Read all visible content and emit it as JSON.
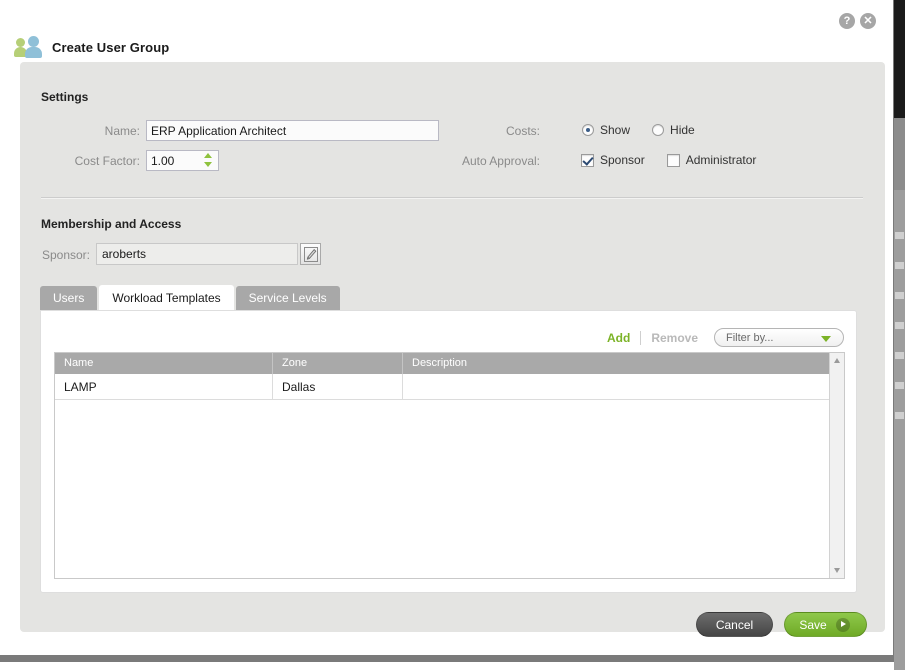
{
  "window": {
    "title": "Create User Group",
    "group_icon": "users-group-icon",
    "help_label": "?",
    "close_label": "✕"
  },
  "settings": {
    "heading": "Settings",
    "name_label": "Name:",
    "name_value": "ERP Application Architect",
    "name_placeholder": "",
    "cost_factor_label": "Cost Factor:",
    "cost_factor_value": "1.00",
    "costs_label": "Costs:",
    "costs_options": [
      {
        "label": "Show",
        "selected": true
      },
      {
        "label": "Hide",
        "selected": false
      }
    ],
    "auto_approval_label": "Auto Approval:",
    "auto_approval_options": [
      {
        "label": "Sponsor",
        "checked": true
      },
      {
        "label": "Administrator",
        "checked": false
      }
    ]
  },
  "membership": {
    "heading": "Membership and Access",
    "sponsor_label": "Sponsor:",
    "sponsor_value": "aroberts",
    "sponsor_placeholder": "",
    "sponsor_edit_icon": "pencil-edit-icon",
    "tabs": [
      {
        "label": "Users",
        "active": false
      },
      {
        "label": "Workload Templates",
        "active": true
      },
      {
        "label": "Service Levels",
        "active": false
      }
    ]
  },
  "table_toolbar": {
    "add_label": "Add",
    "remove_label": "Remove",
    "filter_value": "Filter by...",
    "filter_icon": "chevron-down-icon"
  },
  "table": {
    "columns": [
      "Name",
      "Zone",
      "Description"
    ],
    "rows": [
      {
        "name": "LAMP",
        "zone": "Dallas",
        "description": ""
      }
    ],
    "scrollbar": {
      "up_icon": "scroll-up-arrow-icon",
      "down_icon": "scroll-down-arrow-icon"
    }
  },
  "footer": {
    "cancel_label": "Cancel",
    "save_label": "Save",
    "save_icon": "arrow-right-icon"
  },
  "colors": {
    "accent_green": "#7cb327",
    "save_green": "#6faa26",
    "panel_gray": "#e4e4e2",
    "header_gray": "#a9a9a9",
    "radio_blue": "#3c5e88"
  }
}
